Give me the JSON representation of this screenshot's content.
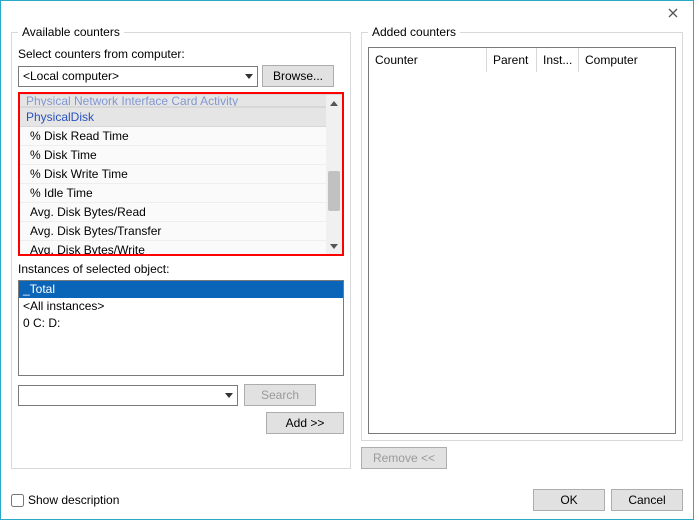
{
  "left": {
    "group_title": "Available counters",
    "select_label": "Select counters from computer:",
    "computer_value": "<Local computer>",
    "browse_label": "Browse...",
    "categories": [
      {
        "name": "Physical Network Interface Card Activity",
        "expanded": false
      },
      {
        "name": "PhysicalDisk",
        "expanded": true,
        "counters": [
          "% Disk Read Time",
          "% Disk Time",
          "% Disk Write Time",
          "% Idle Time",
          "Avg. Disk Bytes/Read",
          "Avg. Disk Bytes/Transfer",
          "Avg. Disk Bytes/Write"
        ]
      }
    ],
    "instances_label": "Instances of selected object:",
    "instances": [
      "_Total",
      "<All instances>",
      "0 C: D:"
    ],
    "selected_instance_index": 0,
    "search_label": "Search",
    "add_label": "Add >>"
  },
  "right": {
    "group_title": "Added counters",
    "columns": [
      "Counter",
      "Parent",
      "Inst...",
      "Computer"
    ],
    "rows": [],
    "remove_label": "Remove <<"
  },
  "footer": {
    "show_description": "Show description",
    "ok": "OK",
    "cancel": "Cancel"
  }
}
